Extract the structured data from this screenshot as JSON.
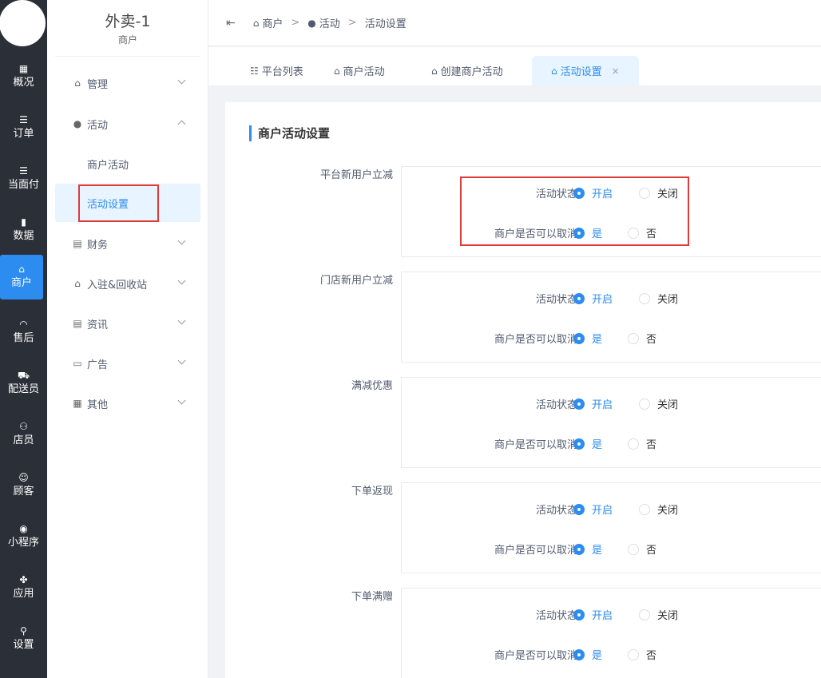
{
  "rail": {
    "items": [
      {
        "icon": "▦",
        "label": "概况"
      },
      {
        "icon": "☰",
        "label": "订单"
      },
      {
        "icon": "☰",
        "label": "当面付"
      },
      {
        "icon": "▮",
        "label": "数据"
      },
      {
        "icon": "⌂",
        "label": "商户"
      },
      {
        "icon": "◠",
        "label": "售后"
      },
      {
        "icon": "⛟",
        "label": "配送员"
      },
      {
        "icon": "⚇",
        "label": "店员"
      },
      {
        "icon": "☺",
        "label": "顾客"
      },
      {
        "icon": "◉",
        "label": "小程序"
      },
      {
        "icon": "✤",
        "label": "应用"
      },
      {
        "icon": "⚲",
        "label": "设置"
      }
    ]
  },
  "sidebar": {
    "brand_title": "外卖-1",
    "brand_sub": "商户",
    "menus": [
      {
        "icon": "⌂",
        "label": "管理"
      },
      {
        "icon": "●",
        "label": "活动"
      },
      {
        "icon": "▤",
        "label": "财务"
      },
      {
        "icon": "⌂",
        "label": "入驻&回收站"
      },
      {
        "icon": "▤",
        "label": "资讯"
      },
      {
        "icon": "▭",
        "label": "广告"
      },
      {
        "icon": "▦",
        "label": "其他"
      }
    ],
    "submenu": [
      "商户活动",
      "活动设置"
    ]
  },
  "topbar": {
    "crumbs": [
      "商户",
      "活动",
      "活动设置"
    ]
  },
  "tabs": [
    "平台列表",
    "商户活动",
    "创建商户活动",
    "活动设置"
  ],
  "content": {
    "title": "商户活动设置",
    "status_label": "活动状态",
    "status_on": "开启",
    "status_off": "关闭",
    "cancel_label": "商户是否可以取消",
    "cancel_yes": "是",
    "cancel_no": "否",
    "rows": [
      "平台新用户立减",
      "门店新用户立减",
      "满减优惠",
      "下单返现",
      "下单满赠"
    ]
  }
}
